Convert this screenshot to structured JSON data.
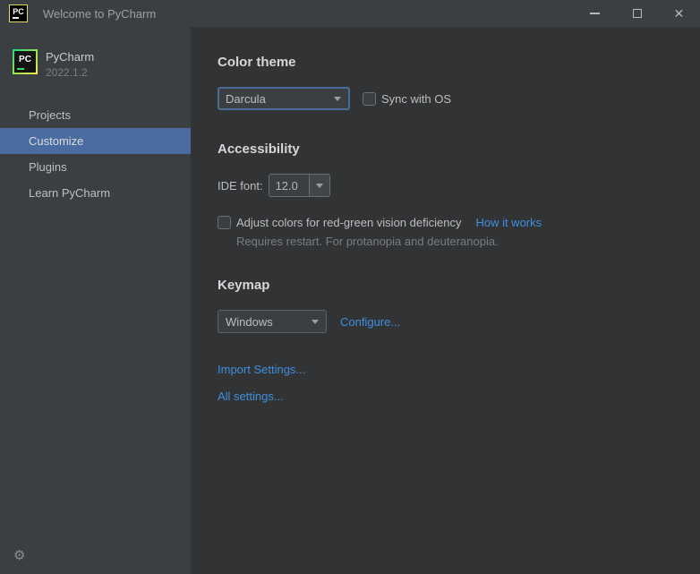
{
  "window": {
    "title": "Welcome to PyCharm"
  },
  "branding": {
    "initials": "PC",
    "product": "PyCharm",
    "version": "2022.1.2"
  },
  "icons": {
    "close": "✕",
    "gear": "⚙",
    "minimize": "minimize-bar",
    "maximize": "maximize-square",
    "chevron": "chevron-down-triangle"
  },
  "sidebar": {
    "items": [
      {
        "label": "Projects",
        "selected": false
      },
      {
        "label": "Customize",
        "selected": true
      },
      {
        "label": "Plugins",
        "selected": false
      },
      {
        "label": "Learn PyCharm",
        "selected": false
      }
    ]
  },
  "main": {
    "color_theme": {
      "heading": "Color theme",
      "theme_select": {
        "value": "Darcula",
        "focused": true
      },
      "sync_checkbox": {
        "label": "Sync with OS",
        "checked": false
      }
    },
    "accessibility": {
      "heading": "Accessibility",
      "ide_font": {
        "label": "IDE font:",
        "value": "12.0"
      },
      "colorblind_checkbox": {
        "label": "Adjust colors for red-green vision deficiency",
        "checked": false
      },
      "how_it_works_link": "How it works",
      "note": "Requires restart. For protanopia and deuteranopia."
    },
    "keymap": {
      "heading": "Keymap",
      "keymap_select": {
        "value": "Windows"
      },
      "configure_link": "Configure..."
    },
    "links": {
      "import_settings": "Import Settings...",
      "all_settings": "All settings..."
    }
  },
  "colors": {
    "titlebar_bg": "#3c3f41",
    "sidebar_bg": "#3c3f41",
    "main_bg": "#313335",
    "selection_bg": "#4b6ca1",
    "link_blue": "#4090df",
    "focus_border_blue": "#466e96",
    "logo_gradient_start": "#21d789",
    "logo_gradient_end": "#f7ec49"
  }
}
